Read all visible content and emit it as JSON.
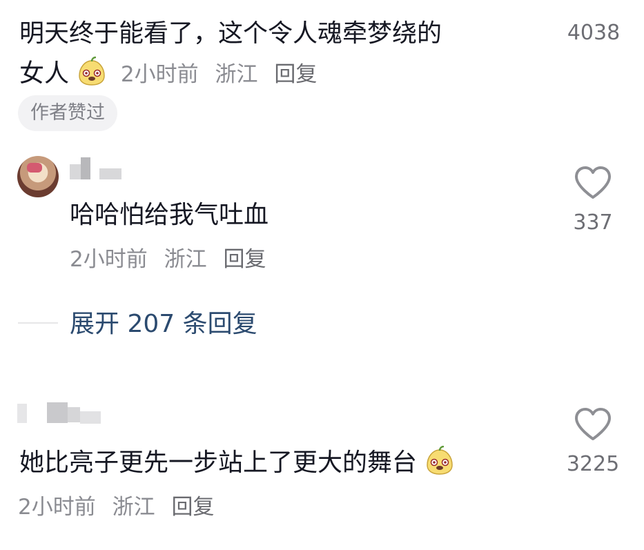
{
  "comment1": {
    "text_line1": "明天终于能看了，这个令人魂牵梦绕的",
    "text_line2": "女人",
    "emoji": "pear-face-emoji",
    "time": "2小时前",
    "location": "浙江",
    "reply_label": "回复",
    "badge": "作者赞过",
    "likes": "4038"
  },
  "reply": {
    "text": "哈哈怕给我气吐血",
    "time": "2小时前",
    "location": "浙江",
    "reply_label": "回复",
    "likes": "337"
  },
  "expand": {
    "label": "展开 207 条回复"
  },
  "comment2": {
    "text": "她比亮子更先一步站上了更大的舞台",
    "emoji": "pear-face-emoji",
    "time": "2小时前",
    "location": "浙江",
    "reply_label": "回复",
    "likes": "3225"
  },
  "icons": {
    "like": "heart-outline-icon",
    "emoji": "pear-face-emoji"
  },
  "colors": {
    "text": "#161823",
    "meta": "#8a8b91",
    "expand": "#2b4a6f",
    "badge_bg": "#f2f2f4"
  }
}
